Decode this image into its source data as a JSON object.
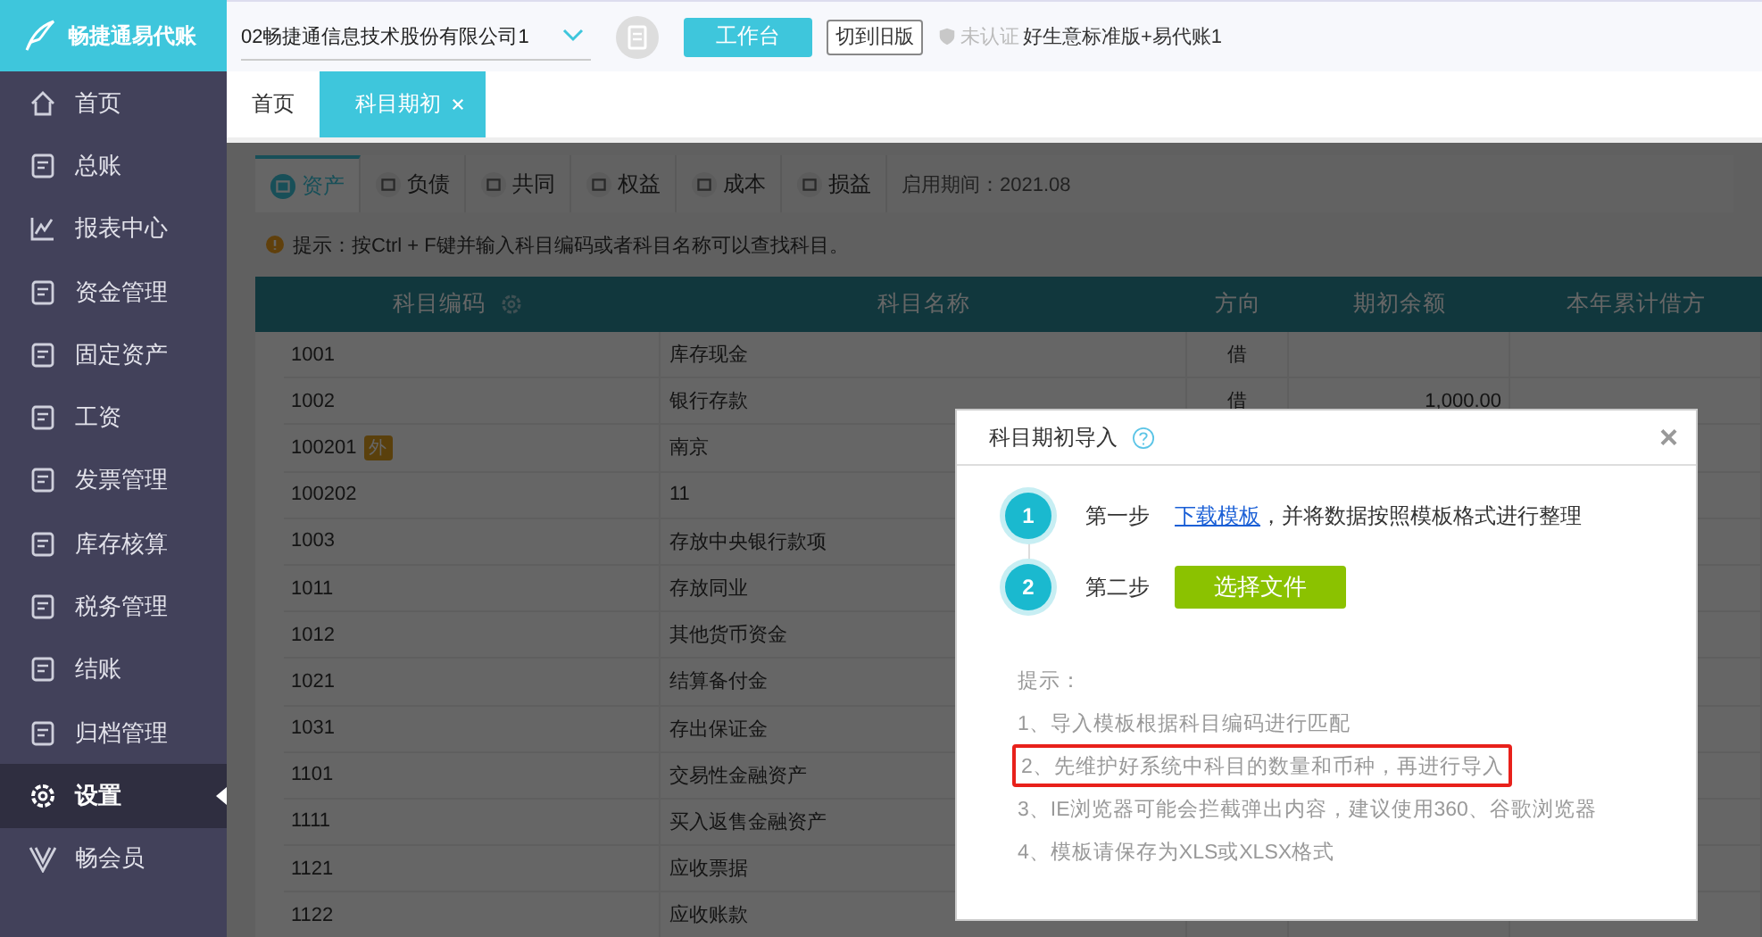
{
  "logo": {
    "text": "畅捷通易代账"
  },
  "sidebar": {
    "items": [
      {
        "label": "首页",
        "selected": false
      },
      {
        "label": "总账",
        "selected": false
      },
      {
        "label": "报表中心",
        "selected": false
      },
      {
        "label": "资金管理",
        "selected": false
      },
      {
        "label": "固定资产",
        "selected": false
      },
      {
        "label": "工资",
        "selected": false
      },
      {
        "label": "发票管理",
        "selected": false
      },
      {
        "label": "库存核算",
        "selected": false
      },
      {
        "label": "税务管理",
        "selected": false
      },
      {
        "label": "结账",
        "selected": false
      },
      {
        "label": "归档管理",
        "selected": false
      },
      {
        "label": "设置",
        "selected": true
      },
      {
        "label": "畅会员",
        "selected": false
      }
    ]
  },
  "header": {
    "company": "02畅捷通信息技术股份有限公司1",
    "workbench_button": "工作台",
    "old_version_button": "切到旧版",
    "certification": "未认证",
    "edition": "好生意标准版+易代账1"
  },
  "page_tabs": [
    {
      "label": "首页",
      "selected": false,
      "closable": false
    },
    {
      "label": "科目期初",
      "selected": true,
      "closable": true
    }
  ],
  "category_tabs": [
    {
      "label": "资产",
      "selected": true
    },
    {
      "label": "负债",
      "selected": false
    },
    {
      "label": "共同",
      "selected": false
    },
    {
      "label": "权益",
      "selected": false
    },
    {
      "label": "成本",
      "selected": false
    },
    {
      "label": "损益",
      "selected": false
    }
  ],
  "start_period": "启用期间：2021.08",
  "tip": "提示：按Ctrl + F键并输入科目编码或者科目名称可以查找科目。",
  "table": {
    "columns": [
      "科目编码",
      "科目名称",
      "方向",
      "期初余额",
      "本年累计借方"
    ],
    "rows": [
      {
        "code": "1001",
        "name": "库存现金",
        "direction": "借"
      },
      {
        "code": "1002",
        "name": "银行存款",
        "direction": "借",
        "balance": "1,000.00"
      },
      {
        "code": "100201",
        "badge": "外",
        "name": "南京"
      },
      {
        "code": "100202",
        "name": "11"
      },
      {
        "code": "1003",
        "name": "存放中央银行款项"
      },
      {
        "code": "1011",
        "name": "存放同业"
      },
      {
        "code": "1012",
        "name": "其他货币资金"
      },
      {
        "code": "1021",
        "name": "结算备付金"
      },
      {
        "code": "1031",
        "name": "存出保证金"
      },
      {
        "code": "1101",
        "name": "交易性金融资产"
      },
      {
        "code": "1111",
        "name": "买入返售金融资产"
      },
      {
        "code": "1121",
        "name": "应收票据"
      },
      {
        "code": "1122",
        "name": "应收账款"
      }
    ]
  },
  "dialog": {
    "title": "科目期初导入",
    "close": "×",
    "steps": [
      {
        "number": "1",
        "label": "第一步",
        "kind": "link",
        "link": "下载模板",
        "text": "，并将数据按照模板格式进行整理"
      },
      {
        "number": "2",
        "label": "第二步",
        "kind": "button",
        "button": "选择文件"
      }
    ],
    "hint_title": "提示：",
    "hints": [
      {
        "text": "1、导入模板根据科目编码进行匹配",
        "highlighted": false
      },
      {
        "text": "2、先维护好系统中科目的数量和币种，再进行导入",
        "highlighted": true
      },
      {
        "text": "3、IE浏览器可能会拦截弹出内容，建议使用360、谷歌浏览器",
        "highlighted": false
      },
      {
        "text": "4、模板请保存为XLS或XLSX格式",
        "highlighted": false
      }
    ]
  }
}
